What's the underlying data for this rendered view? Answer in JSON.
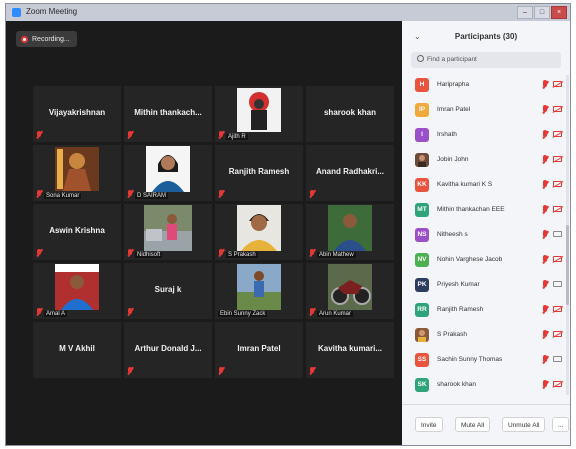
{
  "window": {
    "title": "Zoom Meeting"
  },
  "recording": {
    "label": "Recording..."
  },
  "tiles": [
    {
      "name": "Vijayakrishnan",
      "label": ""
    },
    {
      "name": "Mithin thankach...",
      "label": ""
    },
    {
      "name": "",
      "label": "Ajith R"
    },
    {
      "name": "sharook khan",
      "label": ""
    },
    {
      "name": "",
      "label": "Sona Kumar"
    },
    {
      "name": "",
      "label": "D SAIRAM"
    },
    {
      "name": "Ranjith Ramesh",
      "label": ""
    },
    {
      "name": "Anand Radhakri...",
      "label": ""
    },
    {
      "name": "Aswin Krishna",
      "label": ""
    },
    {
      "name": "",
      "label": "Nidhisoft"
    },
    {
      "name": "",
      "label": "S Prakash"
    },
    {
      "name": "",
      "label": "Abin Mathew"
    },
    {
      "name": "",
      "label": "Amal A"
    },
    {
      "name": "Suraj k",
      "label": ""
    },
    {
      "name": "",
      "label": "Ebin Sunny Zack"
    },
    {
      "name": "",
      "label": "Arun Kumar"
    },
    {
      "name": "M V Akhil",
      "label": ""
    },
    {
      "name": "Arthur Donald J...",
      "label": ""
    },
    {
      "name": "Imran Patel",
      "label": ""
    },
    {
      "name": "Kavitha kumari...",
      "label": ""
    }
  ],
  "panel": {
    "title": "Participants (30)",
    "search_placeholder": "Find a participant",
    "participants": [
      {
        "initials": "H",
        "name": "Hariprapha",
        "color": "#e8543e"
      },
      {
        "initials": "IP",
        "name": "Imran Patel",
        "color": "#f0a93b"
      },
      {
        "initials": "I",
        "name": "Irshath",
        "color": "#9b4fc9"
      },
      {
        "initials": "",
        "name": "Jobin John",
        "color": "#6b4b3a"
      },
      {
        "initials": "KK",
        "name": "Kavitha kumari K S",
        "color": "#e8543e"
      },
      {
        "initials": "MT",
        "name": "Mithin thankachan EEE",
        "color": "#2fa37a"
      },
      {
        "initials": "NS",
        "name": "Nitheesh s",
        "color": "#9b4fc9"
      },
      {
        "initials": "NV",
        "name": "Nohin Varghese Jacob",
        "color": "#4caf50"
      },
      {
        "initials": "PK",
        "name": "Priyesh Kumar",
        "color": "#2d3e5f"
      },
      {
        "initials": "RR",
        "name": "Ranjith Ramesh",
        "color": "#2fa37a"
      },
      {
        "initials": "",
        "name": "S Prakash",
        "color": "#8a5a3a"
      },
      {
        "initials": "SS",
        "name": "Sachin Sunny Thomas",
        "color": "#e8543e"
      },
      {
        "initials": "SK",
        "name": "sharook khan",
        "color": "#2fa37a"
      }
    ],
    "footer": {
      "invite": "Invite",
      "mute_all": "Mute All",
      "unmute_all": "Unmute All",
      "more": "..."
    }
  },
  "colors": {
    "mute_red": "#e53935",
    "zoom_blue": "#2d8cff",
    "tile_bg": "#252525"
  }
}
